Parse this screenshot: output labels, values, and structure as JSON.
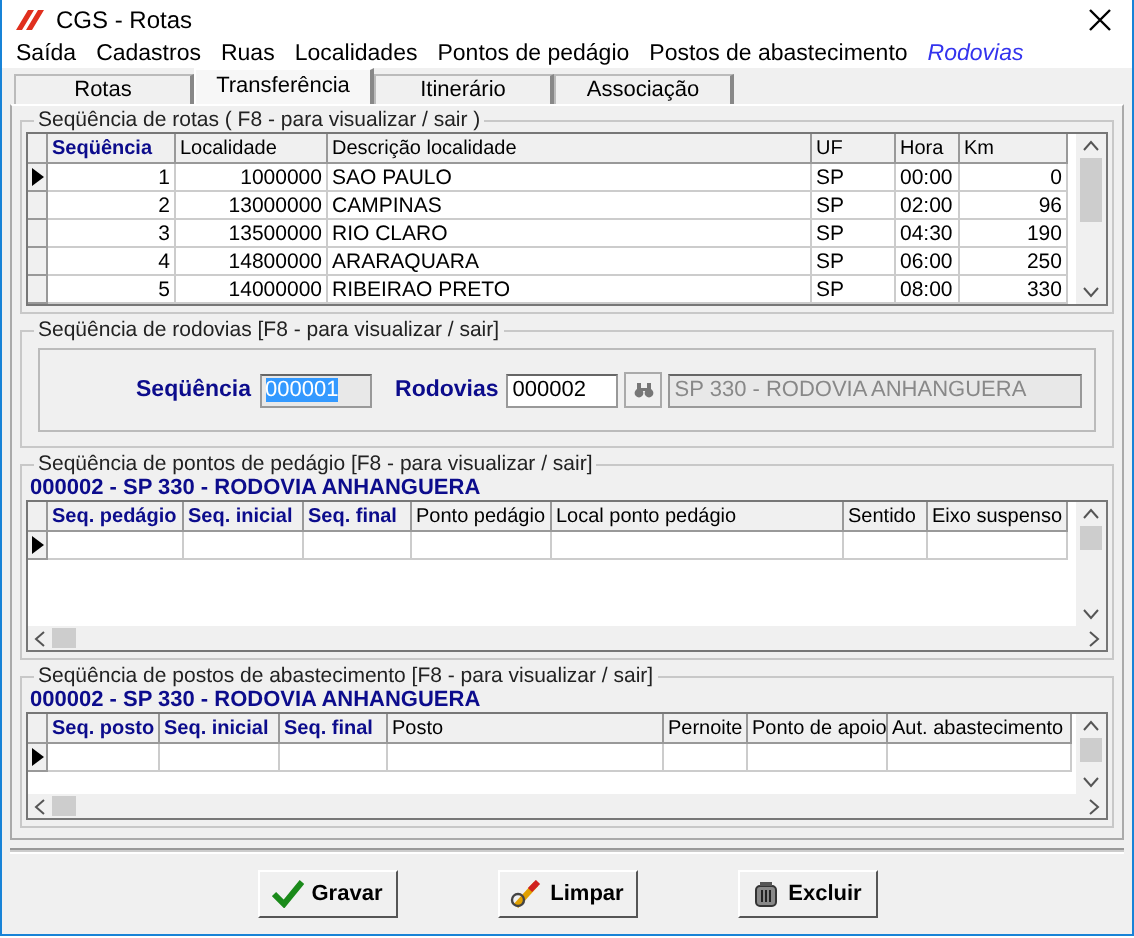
{
  "window": {
    "title": "CGS - Rotas"
  },
  "menu": [
    {
      "label": "Saída",
      "highlighted": false
    },
    {
      "label": "Cadastros",
      "highlighted": false
    },
    {
      "label": "Ruas",
      "highlighted": false
    },
    {
      "label": "Localidades",
      "highlighted": false
    },
    {
      "label": "Pontos de pedágio",
      "highlighted": false
    },
    {
      "label": "Postos de abastecimento",
      "highlighted": false
    },
    {
      "label": "Rodovias",
      "highlighted": true
    }
  ],
  "tabs": [
    {
      "label": "Rotas",
      "selected": false
    },
    {
      "label": "Transferência",
      "selected": true
    },
    {
      "label": "Itinerário",
      "selected": false
    },
    {
      "label": "Associação",
      "selected": false
    }
  ],
  "rotas": {
    "legend": "Seqüência de rotas ( F8 - para visualizar / sair )",
    "columns": [
      {
        "label": "Seqüência",
        "key": true,
        "numeric": true
      },
      {
        "label": "Localidade",
        "key": false,
        "numeric": true
      },
      {
        "label": "Descrição localidade",
        "key": false,
        "numeric": false
      },
      {
        "label": "UF",
        "key": false,
        "numeric": false
      },
      {
        "label": "Hora",
        "key": false,
        "numeric": false
      },
      {
        "label": "Km",
        "key": false,
        "numeric": true
      }
    ],
    "rows": [
      {
        "current": true,
        "cells": [
          "1",
          "1000000",
          "SAO PAULO",
          "SP",
          "00:00",
          "0"
        ]
      },
      {
        "current": false,
        "cells": [
          "2",
          "13000000",
          "CAMPINAS",
          "SP",
          "02:00",
          "96"
        ]
      },
      {
        "current": false,
        "cells": [
          "3",
          "13500000",
          "RIO CLARO",
          "SP",
          "04:30",
          "190"
        ]
      },
      {
        "current": false,
        "cells": [
          "4",
          "14800000",
          "ARARAQUARA",
          "SP",
          "06:00",
          "250"
        ]
      },
      {
        "current": false,
        "cells": [
          "5",
          "14000000",
          "RIBEIRAO PRETO",
          "SP",
          "08:00",
          "330"
        ]
      }
    ]
  },
  "rodovias": {
    "legend": "Seqüência de rodovias [F8 - para visualizar / sair]",
    "sequencia_label": "Seqüência",
    "sequencia_value": "000001",
    "sequencia_text_selected": true,
    "rodovias_label": "Rodovias",
    "rodovias_value": "000002",
    "description": "SP 330 - RODOVIA ANHANGUERA",
    "description_disabled": true
  },
  "lower_grids": [
    {
      "legend": "Seqüência de pontos de pedágio [F8 - para visualizar / sair]",
      "subtitle": "000002 - SP 330 - RODOVIA ANHANGUERA",
      "columns": [
        {
          "label": "Seq. pedágio",
          "key": true
        },
        {
          "label": "Seq. inicial",
          "key": true
        },
        {
          "label": "Seq. final",
          "key": true
        },
        {
          "label": "Ponto pedágio",
          "key": false
        },
        {
          "label": "Local ponto pedágio",
          "key": false
        },
        {
          "label": "Sentido",
          "key": false
        },
        {
          "label": "Eixo suspenso",
          "key": false
        }
      ],
      "rows": [
        {
          "current": true
        }
      ]
    },
    {
      "legend": "Seqüência de postos de abastecimento [F8 - para visualizar / sair]",
      "subtitle": "000002 - SP 330 - RODOVIA ANHANGUERA",
      "columns": [
        {
          "label": "Seq. posto",
          "key": true
        },
        {
          "label": "Seq. inicial",
          "key": true
        },
        {
          "label": "Seq. final",
          "key": true
        },
        {
          "label": "Posto",
          "key": false
        },
        {
          "label": "Pernoite",
          "key": false
        },
        {
          "label": "Ponto de apoio",
          "key": false
        },
        {
          "label": "Aut. abastecimento",
          "key": false
        }
      ],
      "rows": [
        {
          "current": true
        }
      ]
    }
  ],
  "buttons": [
    {
      "label": "Gravar",
      "kind": "save"
    },
    {
      "label": "Limpar",
      "kind": "clear"
    },
    {
      "label": "Excluir",
      "kind": "delete"
    }
  ]
}
